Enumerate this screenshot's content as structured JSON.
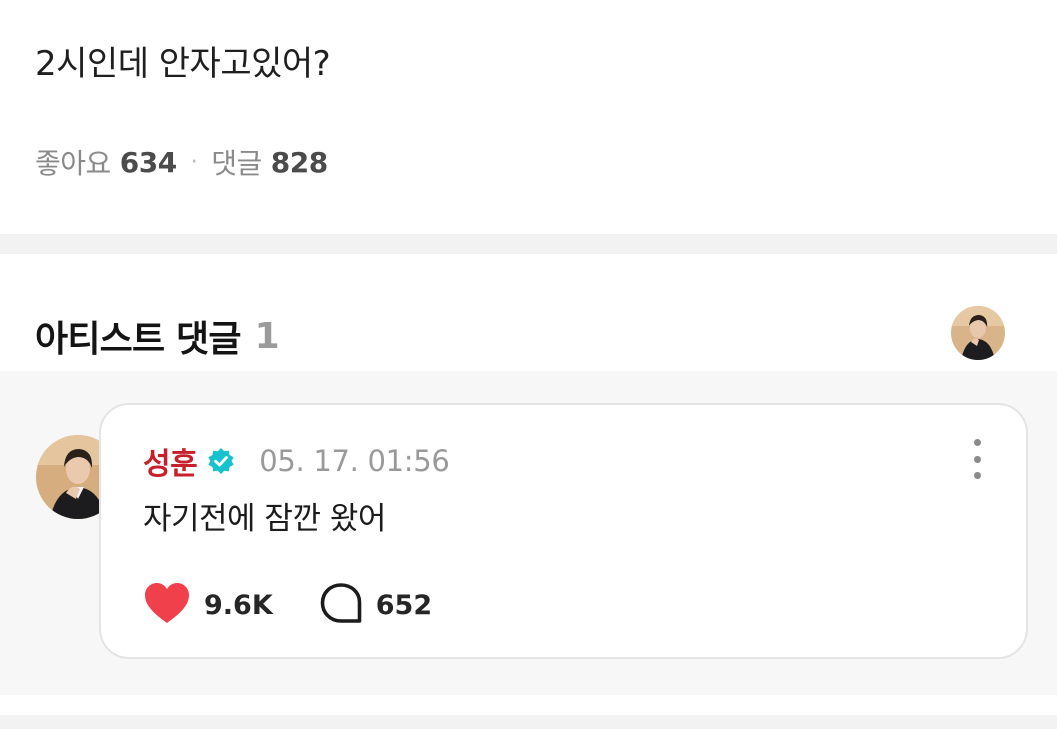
{
  "post": {
    "text": "2시인데 안자고있어?",
    "likes_label": "좋아요",
    "likes_count": "634",
    "separator": "·",
    "comments_label": "댓글",
    "comments_count": "828"
  },
  "artist_comments": {
    "title": "아티스트 댓글",
    "count": "1",
    "header_avatar_icon": "artist-avatar",
    "items": [
      {
        "author": "성훈",
        "verified_icon": "verified-badge-icon",
        "timestamp": "05. 17. 01:56",
        "text": "자기전에 잠깐 왔어",
        "likes": "9.6K",
        "replies": "652",
        "more_icon": "more-vertical-icon",
        "like_icon": "heart-icon",
        "reply_icon": "speech-bubble-icon"
      }
    ]
  },
  "colors": {
    "author": "#c8202b",
    "heart": "#f0404c",
    "verified": "#17c2cf",
    "band": "#f2f2f2",
    "comment_bg": "#f7f7f7"
  }
}
